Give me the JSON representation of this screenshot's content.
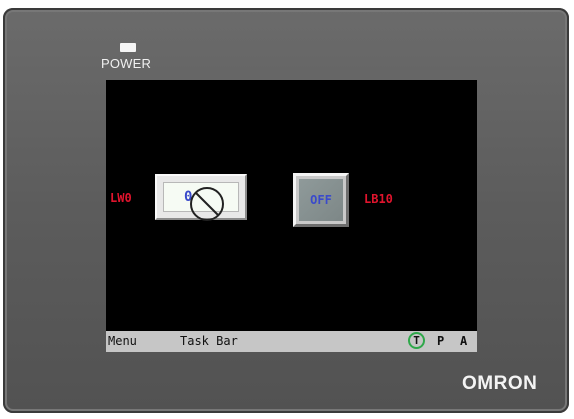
{
  "device": {
    "power_label": "POWER",
    "brand": "OMRON"
  },
  "screen": {
    "numeric_input": {
      "tag": "LW0",
      "value": "0",
      "icon": "no-entry-icon"
    },
    "toggle_button": {
      "label": "OFF",
      "tag": "LB10"
    },
    "taskbar": {
      "menu_label": "Menu",
      "taskbar_label": "Task Bar",
      "indicator_t": "T",
      "indicator_p": "P",
      "indicator_a": "A"
    }
  },
  "colors": {
    "tag_text": "#e0142d",
    "value_text": "#3a4acb",
    "indicator_ring": "#2fa84a"
  }
}
